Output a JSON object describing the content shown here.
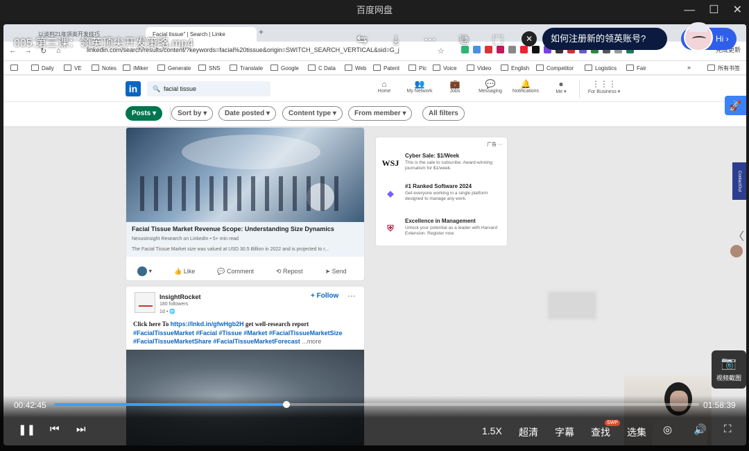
{
  "window": {
    "title": "百度网盘"
  },
  "player": {
    "video_title": "005.第三课：领英顶尖开发策略.mp4",
    "time_current": "00:42:45",
    "time_total": "01:58:39",
    "progress": 0.36,
    "speed": "1.5X",
    "quality": "超清",
    "subtitle": "字幕",
    "search": "查找",
    "episodes": "选集",
    "swp_badge": "SWP",
    "screenshot_label": "视频截图",
    "promo_text": "如何注册新的领英账号?",
    "hi_label": "Hi"
  },
  "browser": {
    "active_tab": "Facial tissue\" | Search | Linke",
    "inactive_tab": "以谈判21年领英开发技巧",
    "url": "linkedin.com/search/results/content/?keywords=facial%20tissue&origin=SWITCH_SEARCH_VERTICAL&sid=G_j",
    "update_label": "完成更新",
    "bookmarks": [
      "Daily",
      "VE",
      "Notes",
      "IMiker",
      "Generate",
      "SNS",
      "Translate",
      "Google",
      "C Data",
      "Web",
      "Patent",
      "Pic",
      "Voice",
      "Video",
      "English",
      "Competitor",
      "Logistics",
      "Fair"
    ],
    "all_bookmarks": "所有书签"
  },
  "linkedin": {
    "logo": "in",
    "search_value": "facial tissue",
    "nav": [
      {
        "label": "Home",
        "icon": "home-icon"
      },
      {
        "label": "My Network",
        "icon": "network-icon"
      },
      {
        "label": "Jobs",
        "icon": "briefcase-icon"
      },
      {
        "label": "Messaging",
        "icon": "message-icon"
      },
      {
        "label": "Notifications",
        "icon": "bell-icon"
      },
      {
        "label": "Me ▾",
        "icon": "avatar-icon"
      },
      {
        "label": "For Business ▾",
        "icon": "grid-icon"
      }
    ],
    "filters": [
      "Posts ▾",
      "Sort by ▾",
      "Date posted ▾",
      "Content type ▾",
      "From member ▾",
      "All filters"
    ],
    "post1": {
      "title": "Facial Tissue Market Revenue Scope: Understanding Size Dynamics",
      "source": "NexusInsight Research on LinkedIn • 5+ min read",
      "snippet": "The Facial Tissue Market size was valued at USD 30.5 Billion in 2022 and is projected to r...",
      "actions": [
        "Like",
        "Comment",
        "Repost",
        "Send"
      ]
    },
    "post2": {
      "author": "InsightRocket",
      "followers": "180 followers",
      "time": "1d • 🌐",
      "follow": "+ Follow",
      "text_prefix": "Click here To ",
      "link": "https://lnkd.in/gfwHgb2H",
      "text_suffix": " get well-research report",
      "tags": "#FacialTissueMarket #Facial #Tissue #Market #FacialTissueMarketSize #FacialTissueMarketShare #FacialTissueMarketForecast",
      "more": "...more"
    },
    "ad": {
      "header": "广告 ···",
      "items": [
        {
          "logo": "WSJ",
          "title": "Cyber Sale: $1/Week",
          "desc": "This is the sale to subscribe. Award-winning journalism for $1/week."
        },
        {
          "logo": "◆",
          "title": "#1 Ranked Software 2024",
          "desc": "Get everyone working in a single platform designed to manage any work."
        },
        {
          "logo": "⛨",
          "title": "Excellence in Management",
          "desc": "Unlock your potential as a leader with Harvard Extension. Register now."
        }
      ]
    },
    "contact_tab": "ContactOut"
  }
}
